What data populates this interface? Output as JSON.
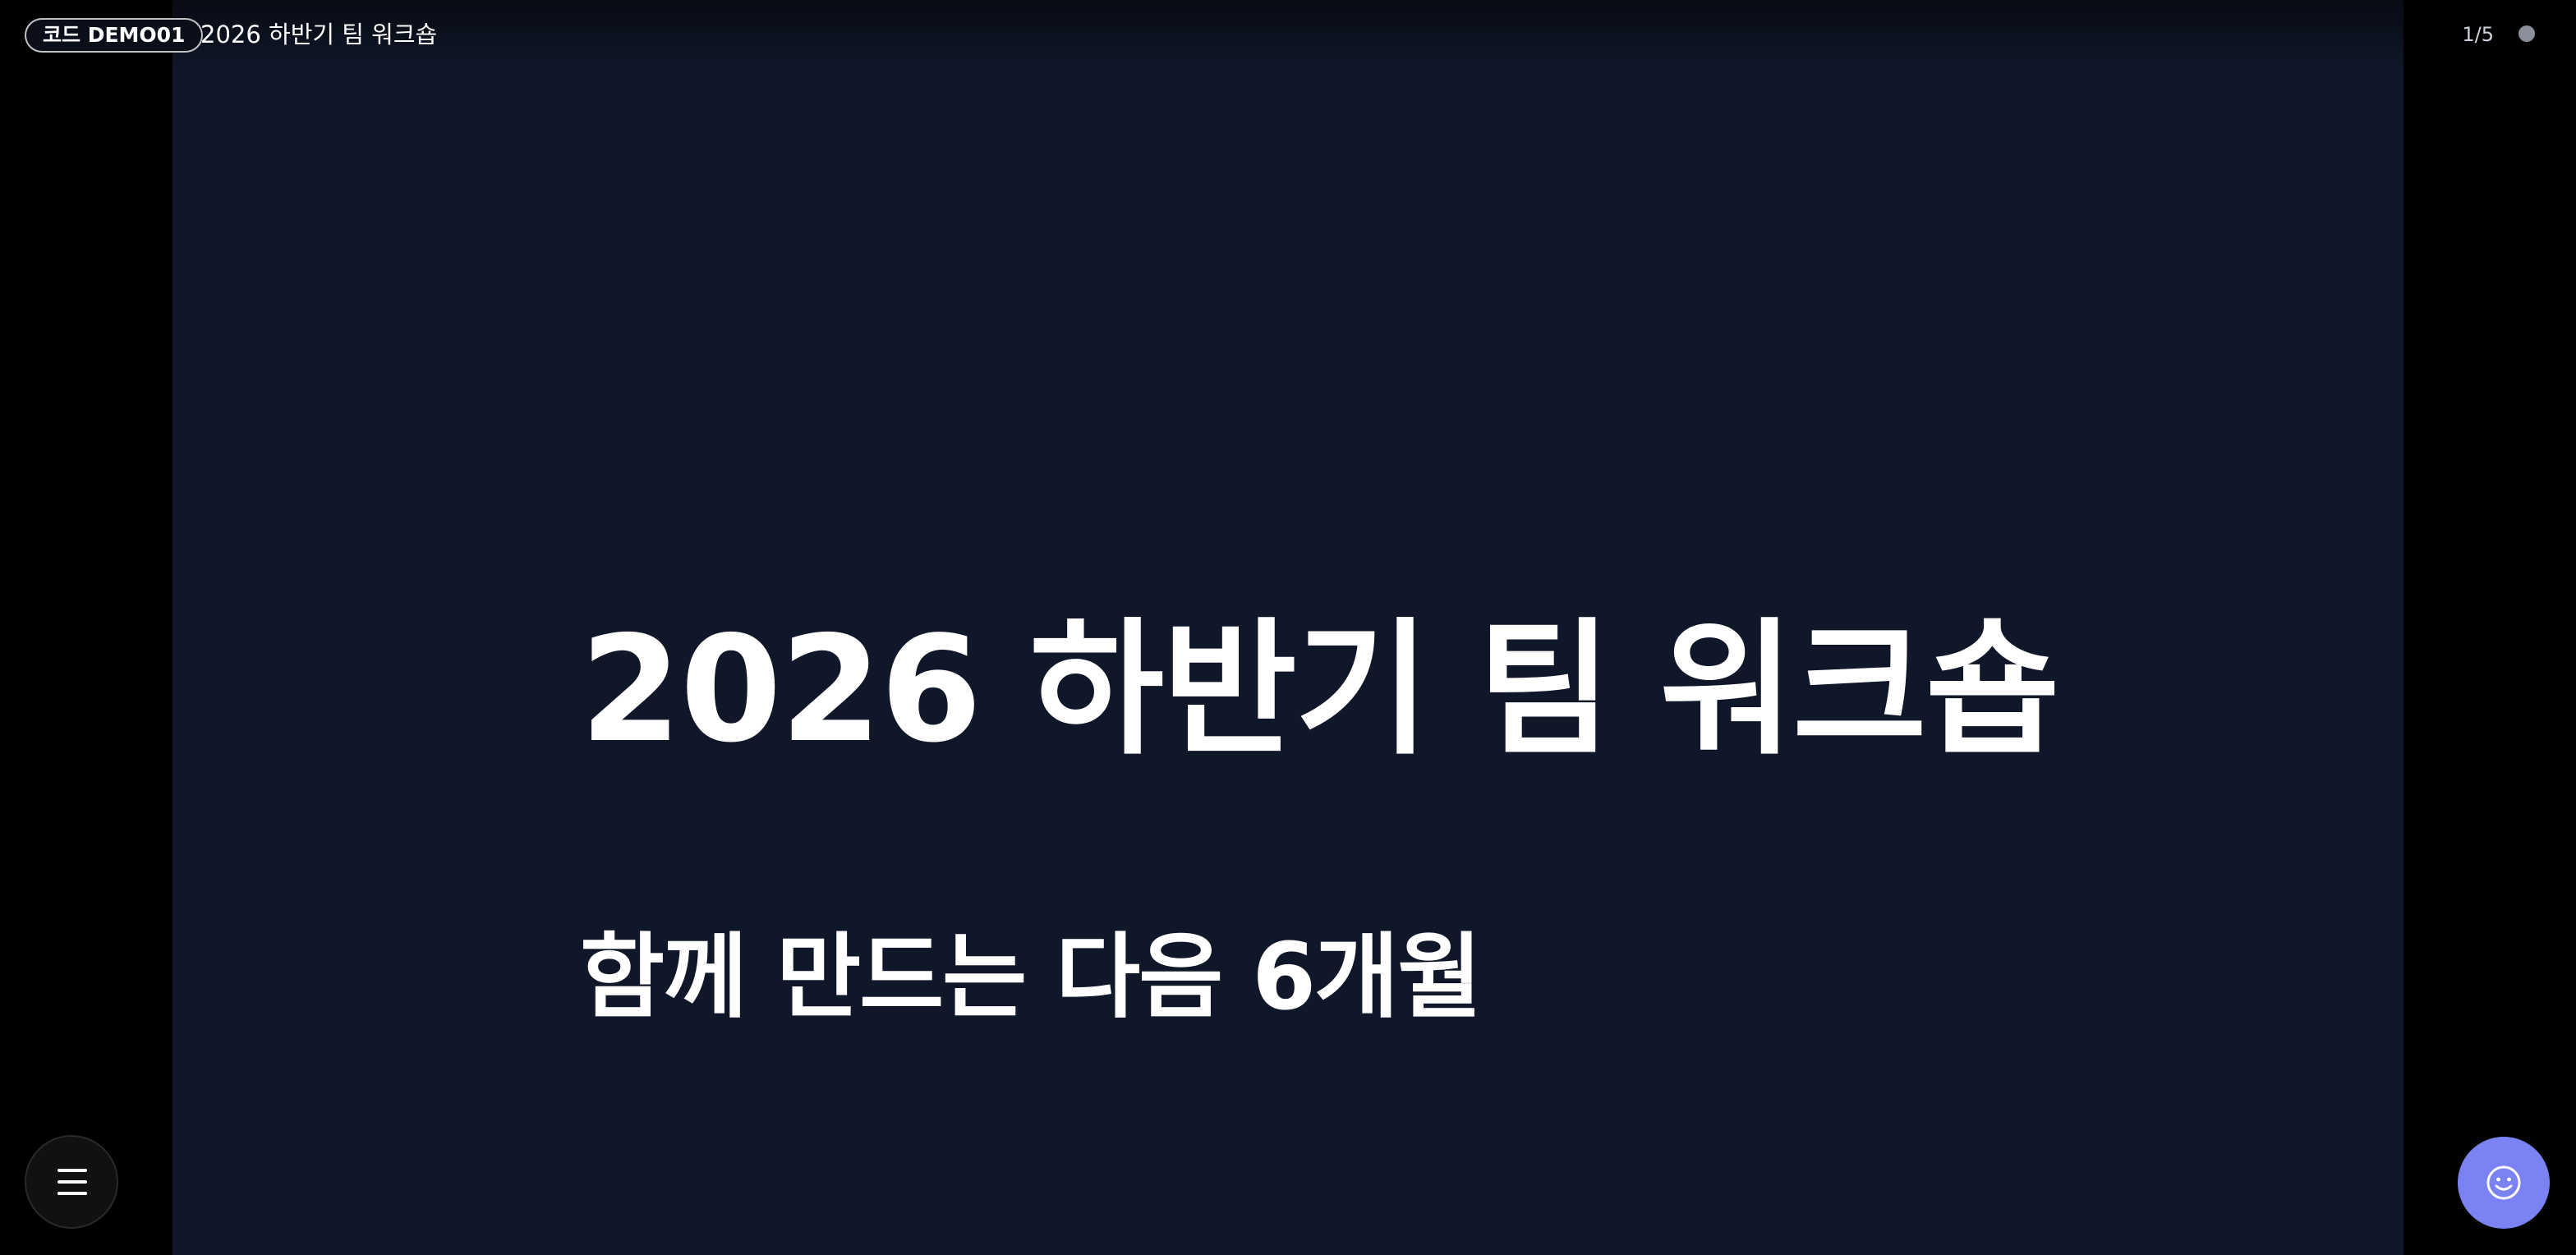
{
  "header": {
    "code_badge": "코드 DEMO01",
    "title": "2026 하반기 팀 워크숍",
    "page_counter": "1/5"
  },
  "slide": {
    "title": "2026 하반기 팀 워크숍",
    "subtitle": "함께 만드는 다음 6개월"
  },
  "controls": {
    "menu_icon": "hamburger-menu-icon",
    "reaction_icon": "smiley-face-icon"
  },
  "colors": {
    "background": "#000000",
    "slide_background": "#101729",
    "accent": "#7b83f3",
    "text": "#ffffff",
    "status_dot": "#8a8f99"
  }
}
